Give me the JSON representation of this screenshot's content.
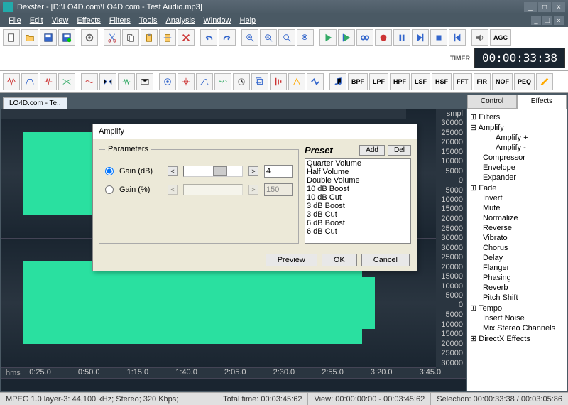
{
  "window": {
    "title": "Dexster - [D:\\LO4D.com\\LO4D.com - Test Audio.mp3]"
  },
  "menu": [
    "File",
    "Edit",
    "View",
    "Effects",
    "Filters",
    "Tools",
    "Analysis",
    "Window",
    "Help"
  ],
  "timer": {
    "label": "TIMER",
    "value": "00:00:33:38"
  },
  "tab": {
    "label": "LO4D.com - Te.."
  },
  "side": {
    "tabs": {
      "control": "Control",
      "effects": "Effects"
    },
    "tree": [
      {
        "lvl": 1,
        "label": "Filters",
        "open": false
      },
      {
        "lvl": 1,
        "label": "Amplify",
        "open": true
      },
      {
        "lvl": 3,
        "label": "Amplify +"
      },
      {
        "lvl": 3,
        "label": "Amplify -"
      },
      {
        "lvl": 2,
        "label": "Compressor"
      },
      {
        "lvl": 2,
        "label": "Envelope"
      },
      {
        "lvl": 2,
        "label": "Expander"
      },
      {
        "lvl": 1,
        "label": "Fade",
        "open": false
      },
      {
        "lvl": 2,
        "label": "Invert"
      },
      {
        "lvl": 2,
        "label": "Mute"
      },
      {
        "lvl": 2,
        "label": "Normalize"
      },
      {
        "lvl": 2,
        "label": "Reverse"
      },
      {
        "lvl": 2,
        "label": "Vibrato"
      },
      {
        "lvl": 2,
        "label": "Chorus"
      },
      {
        "lvl": 2,
        "label": "Delay"
      },
      {
        "lvl": 2,
        "label": "Flanger"
      },
      {
        "lvl": 2,
        "label": "Phasing"
      },
      {
        "lvl": 2,
        "label": "Reverb"
      },
      {
        "lvl": 2,
        "label": "Pitch Shift"
      },
      {
        "lvl": 1,
        "label": "Tempo",
        "open": false
      },
      {
        "lvl": 2,
        "label": "Insert Noise"
      },
      {
        "lvl": 2,
        "label": "Mix Stereo Channels"
      },
      {
        "lvl": 1,
        "label": "DirectX Effects",
        "open": false
      }
    ]
  },
  "ruler": {
    "smpl": "smpl",
    "hms": "hms",
    "top_ticks": [
      "30000",
      "25000",
      "20000",
      "15000",
      "10000",
      "5000",
      "0",
      "5000",
      "10000",
      "15000",
      "20000",
      "25000",
      "30000"
    ],
    "bottom_ticks": [
      "0:25.0",
      "0:50.0",
      "1:15.0",
      "1:40.0",
      "2:05.0",
      "2:30.0",
      "2:55.0",
      "3:20.0",
      "3:45.0"
    ]
  },
  "status": {
    "format": "MPEG 1.0 layer-3: 44,100 kHz; Stereo; 320 Kbps;",
    "total": "Total time: 00:03:45:62",
    "view": "View: 00:00:00:00 - 00:03:45:62",
    "selection": "Selection: 00:00:33:38 / 00:03:05:86"
  },
  "dialog": {
    "title": "Amplify",
    "fieldset": "Parameters",
    "gain_db_label": "Gain (dB)",
    "gain_pct_label": "Gain (%)",
    "gain_db_value": "4",
    "gain_pct_value": "150",
    "preset_label": "Preset",
    "add": "Add",
    "del": "Del",
    "presets": [
      "Quarter Volume",
      "Half Volume",
      "Double Volume",
      "10 dB Boost",
      "10 dB Cut",
      "3 dB Boost",
      "3 dB Cut",
      "6 dB Boost",
      "6 dB Cut"
    ],
    "preview": "Preview",
    "ok": "OK",
    "cancel": "Cancel"
  },
  "toolbar_text": {
    "bpf": "BPF",
    "lpf": "LPF",
    "hpf": "HPF",
    "lsf": "LSF",
    "hsf": "HSF",
    "fft": "FFT",
    "fir": "FIR",
    "nof": "NOF",
    "peq": "PEQ",
    "agc": "AGC"
  },
  "watermark": "LO4D.com"
}
